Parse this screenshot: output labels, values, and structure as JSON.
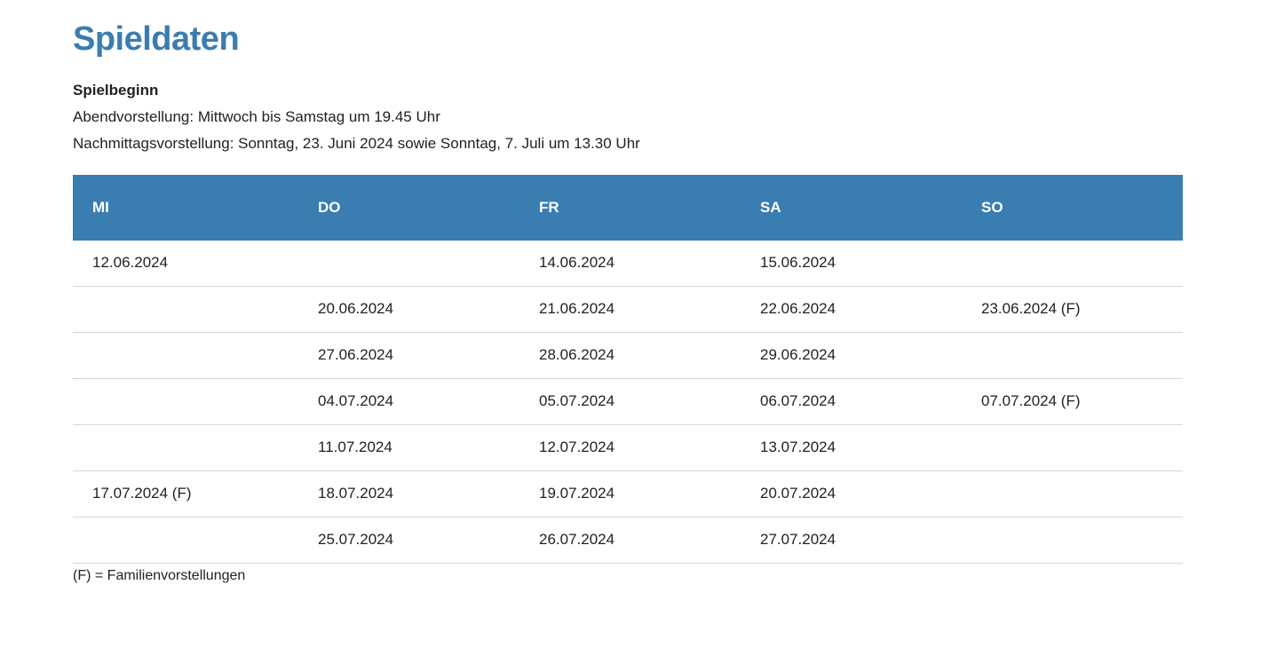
{
  "title": "Spieldaten",
  "subheading": "Spielbeginn",
  "info_lines": [
    "Abendvorstellung: Mittwoch bis Samstag um 19.45 Uhr",
    "Nachmittagsvorstellung: Sonntag, 23. Juni 2024 sowie Sonntag, 7. Juli um 13.30 Uhr"
  ],
  "table": {
    "headers": [
      "MI",
      "DO",
      "FR",
      "SA",
      "SO"
    ],
    "rows": [
      [
        "12.06.2024",
        "",
        "14.06.2024",
        "15.06.2024",
        ""
      ],
      [
        "",
        "20.06.2024",
        "21.06.2024",
        "22.06.2024",
        "23.06.2024 (F)"
      ],
      [
        "",
        "27.06.2024",
        "28.06.2024",
        "29.06.2024",
        ""
      ],
      [
        "",
        "04.07.2024",
        "05.07.2024",
        "06.07.2024",
        "07.07.2024 (F)"
      ],
      [
        "",
        "11.07.2024",
        "12.07.2024",
        "13.07.2024",
        ""
      ],
      [
        "17.07.2024 (F)",
        "18.07.2024",
        "19.07.2024",
        "20.07.2024",
        ""
      ],
      [
        "",
        "25.07.2024",
        "26.07.2024",
        "27.07.2024",
        ""
      ]
    ]
  },
  "legend": "(F) = Familienvorstellungen",
  "colors": {
    "accent": "#3a7db1",
    "text": "#222222",
    "row_border": "#d6d6d6"
  }
}
